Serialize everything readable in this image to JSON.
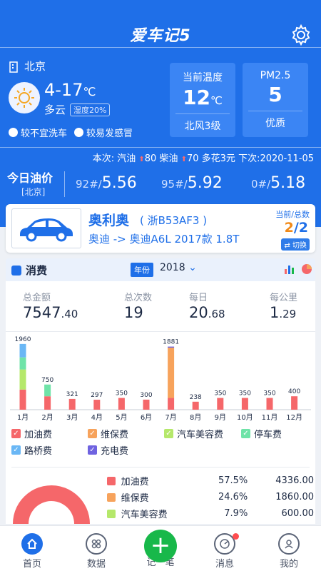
{
  "app": {
    "title": "爱车记5"
  },
  "weather": {
    "city": "北京",
    "temp": "4-17",
    "unit": "℃",
    "condition": "多云",
    "humidity": "湿度20%",
    "tip_wash": "较不宜洗车",
    "tip_cold": "较易发感冒"
  },
  "current_temp": {
    "label": "当前温度",
    "value": "12",
    "unit": "℃",
    "wind": "北风3级"
  },
  "pm25": {
    "label": "PM2.5",
    "value": "5",
    "quality": "优质"
  },
  "oil_update": {
    "text": "本次: 汽油 ",
    "gas": "80",
    "diesel_lbl": " 柴油 ",
    "diesel": "70",
    "spend": " 多花3元  下次:2020-11-05"
  },
  "today_oil": {
    "title": "今日油价",
    "city": "[北京]",
    "p92_lbl": "92#/",
    "p92": "5.56",
    "p95_lbl": "95#/",
    "p95": "5.92",
    "p0_lbl": "0#/",
    "p0": "5.18"
  },
  "car": {
    "name": "奥利奥",
    "plate": "( 浙B53AF3 )",
    "model": "奥迪 -> 奥迪A6L  2017款  1.8T",
    "count_label": "当前/总数",
    "current": "2",
    "total": "/2",
    "switch": "⇄ 切换"
  },
  "section": {
    "title": "消费",
    "year_tag": "年份",
    "year": "2018"
  },
  "stats": [
    {
      "label": "总金额",
      "int": "7547",
      "dec": ".40"
    },
    {
      "label": "总次数",
      "int": "19",
      "dec": ""
    },
    {
      "label": "每日",
      "int": "20",
      "dec": ".68"
    },
    {
      "label": "每公里",
      "int": "1",
      "dec": ".29"
    }
  ],
  "colors": {
    "fuel": "#f5676a",
    "maint": "#f7a35c",
    "beauty": "#b5e86b",
    "park": "#6fe3a8",
    "toll": "#6ab7f5",
    "charge": "#6f63e0",
    "blue": "#1f6fe8"
  },
  "chart_data": {
    "type": "bar",
    "categories": [
      "1月",
      "2月",
      "3月",
      "4月",
      "5月",
      "6月",
      "7月",
      "8月",
      "9月",
      "10月",
      "11月",
      "12月"
    ],
    "totals": [
      "1960",
      "750",
      "321",
      "297",
      "350",
      "300",
      "1881",
      "238",
      "350",
      "350",
      "350",
      "400"
    ],
    "series": [
      {
        "name": "加油费",
        "values": [
          600,
          400,
          321,
          297,
          350,
          300,
          350,
          238,
          350,
          350,
          350,
          400
        ]
      },
      {
        "name": "维保费",
        "values": [
          0,
          0,
          0,
          0,
          0,
          0,
          1500,
          0,
          0,
          0,
          0,
          0
        ]
      },
      {
        "name": "汽车美容费",
        "values": [
          600,
          0,
          0,
          0,
          0,
          0,
          0,
          0,
          0,
          0,
          0,
          0
        ]
      },
      {
        "name": "停车费",
        "values": [
          360,
          350,
          0,
          0,
          0,
          0,
          0,
          0,
          0,
          0,
          0,
          0
        ]
      },
      {
        "name": "路桥费",
        "values": [
          400,
          0,
          0,
          0,
          0,
          0,
          0,
          0,
          0,
          0,
          0,
          0
        ]
      },
      {
        "name": "充电费",
        "values": [
          0,
          0,
          0,
          0,
          0,
          0,
          31,
          0,
          0,
          0,
          0,
          0
        ]
      }
    ],
    "ylim": [
      0,
      2000
    ]
  },
  "legend": [
    "加油费",
    "维保费",
    "汽车美容费",
    "停车费",
    "路桥费",
    "充电费"
  ],
  "breakdown": [
    {
      "name": "加油费",
      "pct": "57.5%",
      "amount": "4336.00",
      "color": "#f5676a",
      "share": 0.575
    },
    {
      "name": "维保费",
      "pct": "24.6%",
      "amount": "1860.00",
      "color": "#f7a35c",
      "share": 0.246
    },
    {
      "name": "汽车美容费",
      "pct": "7.9%",
      "amount": "600.00",
      "color": "#b5e86b",
      "share": 0.079
    }
  ],
  "tabs": {
    "home": "首页",
    "data": "数据",
    "record": "记一笔",
    "msg": "消息",
    "mine": "我的"
  }
}
